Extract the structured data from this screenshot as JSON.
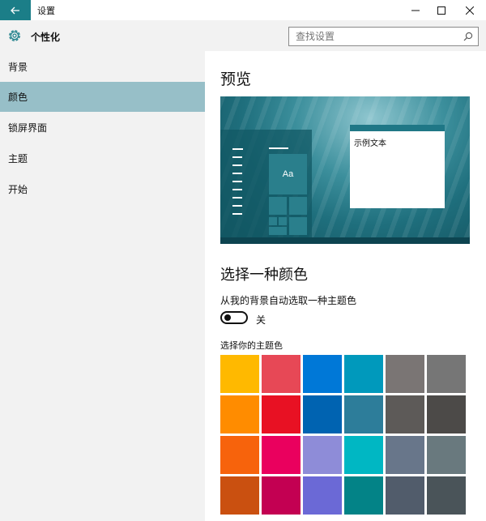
{
  "window": {
    "title": "设置",
    "icons": {
      "back": "back-arrow-icon",
      "minimize": "minimize-icon",
      "maximize": "maximize-icon",
      "close": "close-icon"
    }
  },
  "header": {
    "title": "个性化",
    "icon": "gear-icon",
    "search": {
      "placeholder": "查找设置",
      "value": ""
    }
  },
  "sidebar": {
    "items": [
      {
        "label": "背景",
        "active": false
      },
      {
        "label": "颜色",
        "active": true
      },
      {
        "label": "锁屏界面",
        "active": false
      },
      {
        "label": "主题",
        "active": false
      },
      {
        "label": "开始",
        "active": false
      }
    ]
  },
  "main": {
    "preview_heading": "预览",
    "preview": {
      "tile_text": "Aa",
      "sample_text": "示例文本"
    },
    "choose_heading": "选择一种颜色",
    "auto_label": "从我的背景自动选取一种主题色",
    "auto_toggle": {
      "state": "关",
      "on": false
    },
    "accent_label": "选择你的主题色",
    "swatches": [
      [
        "#ffb900",
        "#e74856",
        "#0078d7",
        "#0099bc",
        "#7a7574",
        "#767676"
      ],
      [
        "#ff8c00",
        "#e81123",
        "#0063b1",
        "#2d7d9a",
        "#5d5a58",
        "#4c4a48"
      ],
      [
        "#f7630c",
        "#ea005e",
        "#8e8cd8",
        "#00b7c3",
        "#68768a",
        "#69797e"
      ],
      [
        "#ca5010",
        "#c30052",
        "#6b69d6",
        "#038387",
        "#515c6b",
        "#4a5459"
      ]
    ]
  }
}
